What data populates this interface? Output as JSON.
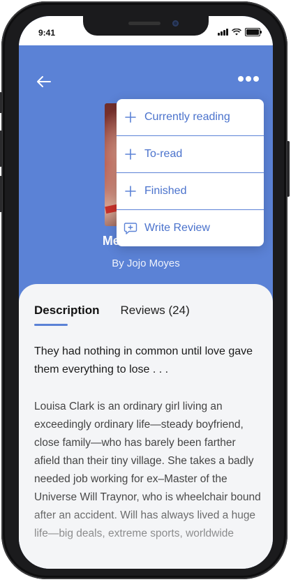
{
  "status_bar": {
    "time": "9:41",
    "battery_level": 1.0
  },
  "header": {
    "back_icon": "arrow-left-icon",
    "more_icon": "more-horizontal-icon"
  },
  "book": {
    "title": "Me Before You",
    "author": "By Jojo Moyes"
  },
  "menu": {
    "items": [
      {
        "label": "Currently reading",
        "icon": "plus-icon"
      },
      {
        "label": "To-read",
        "icon": "plus-icon"
      },
      {
        "label": "Finished",
        "icon": "plus-icon"
      },
      {
        "label": "Write Review",
        "icon": "review-icon"
      }
    ]
  },
  "tabs": [
    {
      "label": "Description",
      "active": true
    },
    {
      "label": "Reviews (24)",
      "active": false
    }
  ],
  "description": {
    "tagline": "They had nothing in common until love gave them everything to lose . . .",
    "body": "Louisa Clark is an ordinary girl living an exceedingly ordinary life—steady boyfriend, close family—who has barely been farther afield than their tiny village. She takes a badly needed job working for ex–Master of the Universe Will Traynor, who is wheelchair bound after an accident. Will has always lived a huge life—big deals, extreme sports, worldwide"
  },
  "colors": {
    "accent": "#5b82d6",
    "menu_text": "#4a72cc",
    "panel_bg": "#f4f5f7"
  }
}
